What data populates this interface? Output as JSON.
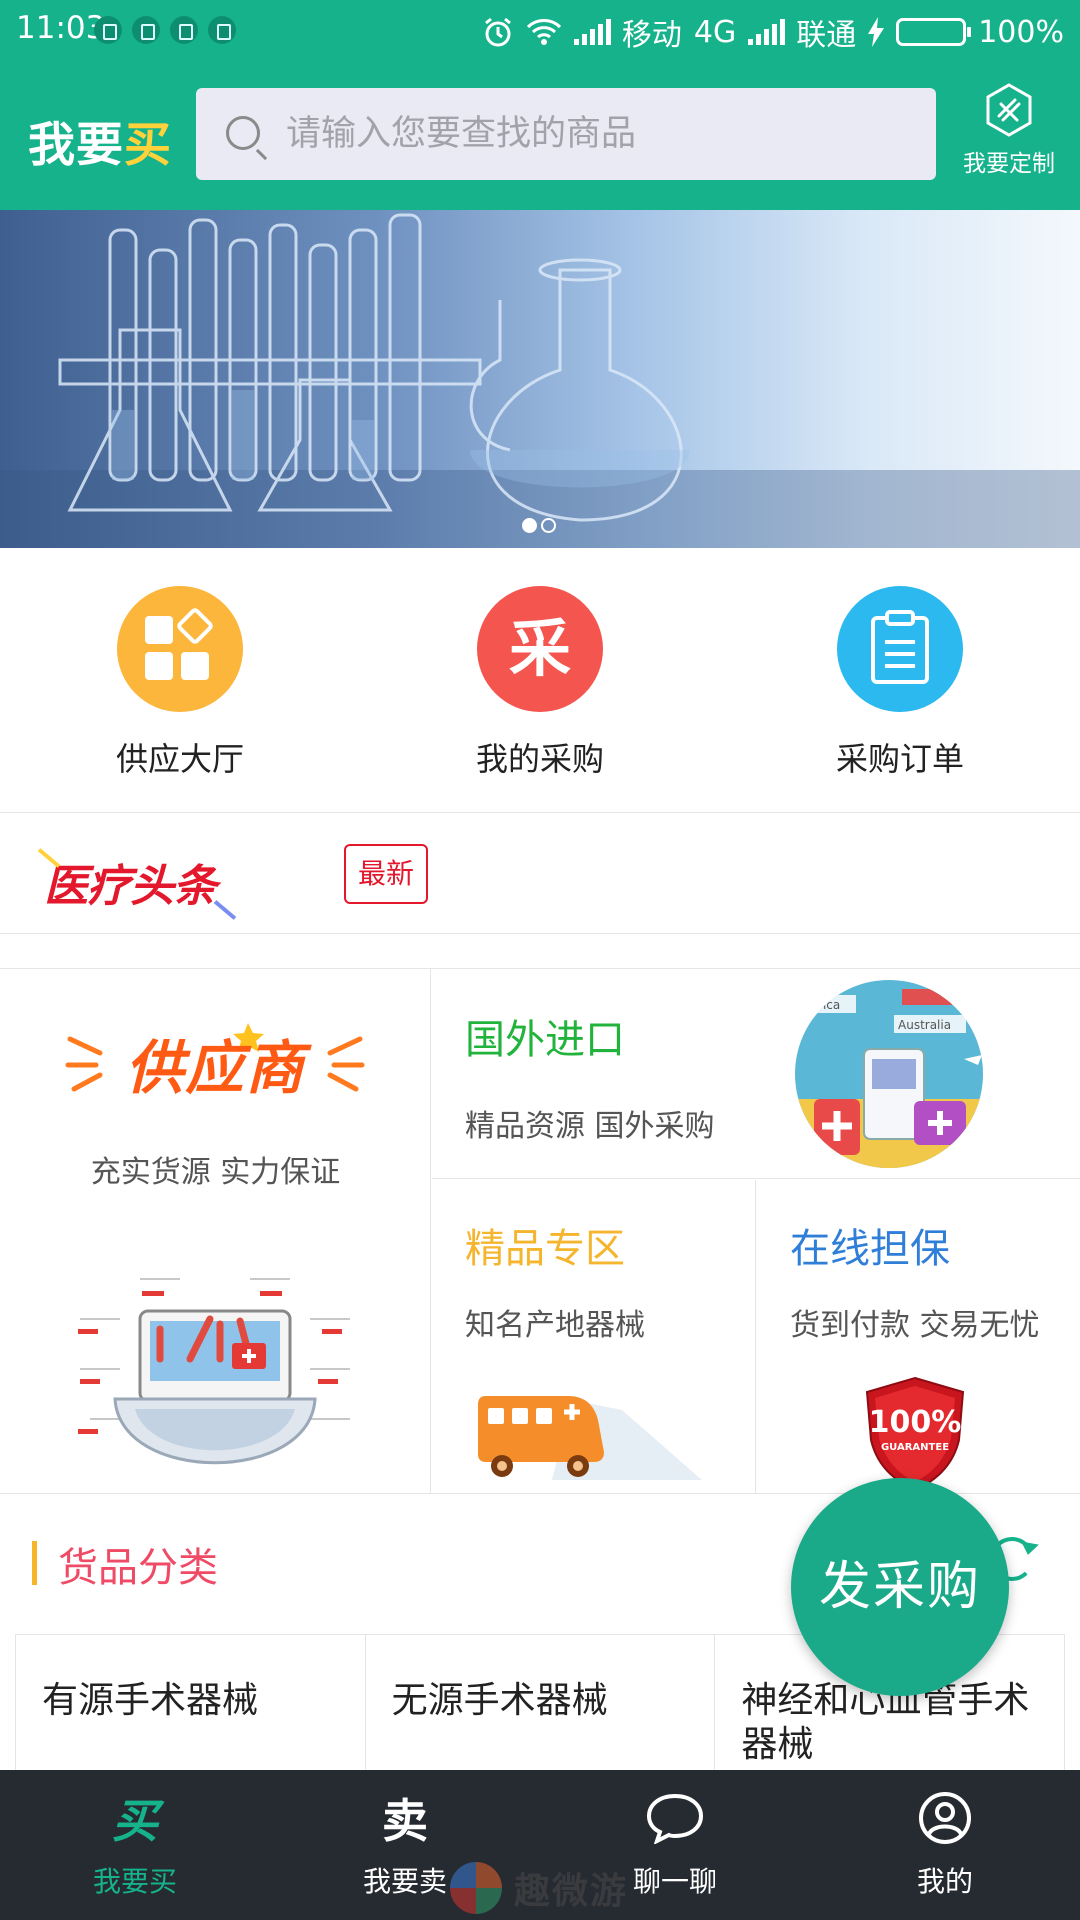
{
  "status_bar": {
    "time": "11:03",
    "carrier1": "移动",
    "network": "4G",
    "carrier2": "联通",
    "battery": "100%",
    "battery_level": 1.0,
    "icons": [
      "shield-icon",
      "alarm-icon",
      "wifi-icon",
      "signal-icon",
      "charging-icon"
    ]
  },
  "header": {
    "brand_prefix": "我要",
    "brand_accent": "买",
    "search_placeholder": "请输入您要查找的商品",
    "custom_label": "我要定制",
    "colors": {
      "primary": "#15b28b",
      "accent": "#ffd23c"
    }
  },
  "banner": {
    "slide_count": 2,
    "active_index": 0
  },
  "quick_actions": [
    {
      "label": "供应大厅",
      "icon": "grid-icon",
      "color": "#fcb63b"
    },
    {
      "label": "我的采购",
      "icon": "purchase-icon",
      "glyph": "采",
      "color": "#f4564f"
    },
    {
      "label": "采购订单",
      "icon": "clipboard-icon",
      "color": "#2bb9ef"
    }
  ],
  "headline": {
    "logo_text": "医疗头条",
    "badge": "最新"
  },
  "features": {
    "supplier": {
      "logo_text": "供应商",
      "subtitle": "充实货源 实力保证"
    },
    "import": {
      "title": "国外进口",
      "subtitle": "精品资源 国外采购",
      "title_color": "#22b33d",
      "illustration_labels": [
        "Africa",
        "Australia"
      ]
    },
    "premium": {
      "title": "精品专区",
      "subtitle": "知名产地器械",
      "title_color": "#f5b52e"
    },
    "guarantee": {
      "title": "在线担保",
      "subtitle": "货到付款 交易无忧",
      "title_color": "#2f7fd8",
      "badge_top": "100%",
      "badge_bottom": "GUARANTEE"
    }
  },
  "category": {
    "title": "货品分类",
    "items": [
      "有源手术器械",
      "无源手术器械",
      "神经和心血管手术器械"
    ]
  },
  "fab": {
    "label": "发采购"
  },
  "bottom_nav": [
    {
      "label": "我要买",
      "glyph": "买",
      "icon": "buy-icon",
      "active": true
    },
    {
      "label": "我要卖",
      "glyph": "卖",
      "icon": "sell-icon",
      "active": false
    },
    {
      "label": "聊一聊",
      "icon": "chat-icon",
      "active": false
    },
    {
      "label": "我的",
      "icon": "profile-icon",
      "active": false
    }
  ],
  "watermark": {
    "text": "趣微游"
  }
}
